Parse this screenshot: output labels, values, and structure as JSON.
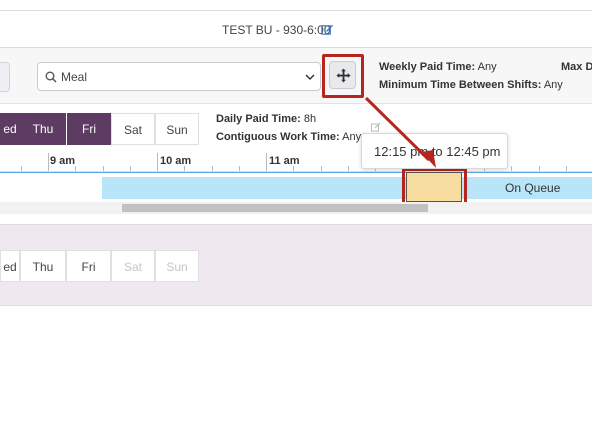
{
  "header": {
    "title": "TEST BU - 930-6:00",
    "edit_icon": "edit-icon"
  },
  "toolbar": {
    "activity_select": {
      "value": "Meal",
      "icon": "search-icon"
    },
    "move_button_icon": "move-icon",
    "weekly_paid_label": "Weekly Paid Time:",
    "weekly_paid_value": "Any",
    "max_label": "Max D",
    "min_between_label": "Minimum Time Between Shifts:",
    "min_between_value": "Any"
  },
  "days": [
    {
      "label": "ed",
      "selected": true
    },
    {
      "label": "Thu",
      "selected": true
    },
    {
      "label": "Fri",
      "selected": true
    },
    {
      "label": "Sat",
      "selected": false
    },
    {
      "label": "Sun",
      "selected": false
    }
  ],
  "daily": {
    "paid_label": "Daily Paid Time:",
    "paid_value": "8h",
    "contiguous_label": "Contiguous Work Time:",
    "contiguous_value": "Any"
  },
  "tooltip": {
    "text": "12:15 pm to 12:45 pm"
  },
  "timeline": {
    "labels": [
      "9 am",
      "10 am",
      "11 am"
    ]
  },
  "schedule": {
    "queue_label": "On Queue"
  },
  "lower_days": [
    {
      "label": "ed",
      "disabled": false
    },
    {
      "label": "Thu",
      "disabled": false
    },
    {
      "label": "Fri",
      "disabled": false
    },
    {
      "label": "Sat",
      "disabled": true
    },
    {
      "label": "Sun",
      "disabled": true
    }
  ],
  "colors": {
    "highlight": "#b5261f",
    "day_selected": "#5d3b63",
    "queue": "#b8e6f8",
    "meal": "#f8dda0"
  }
}
